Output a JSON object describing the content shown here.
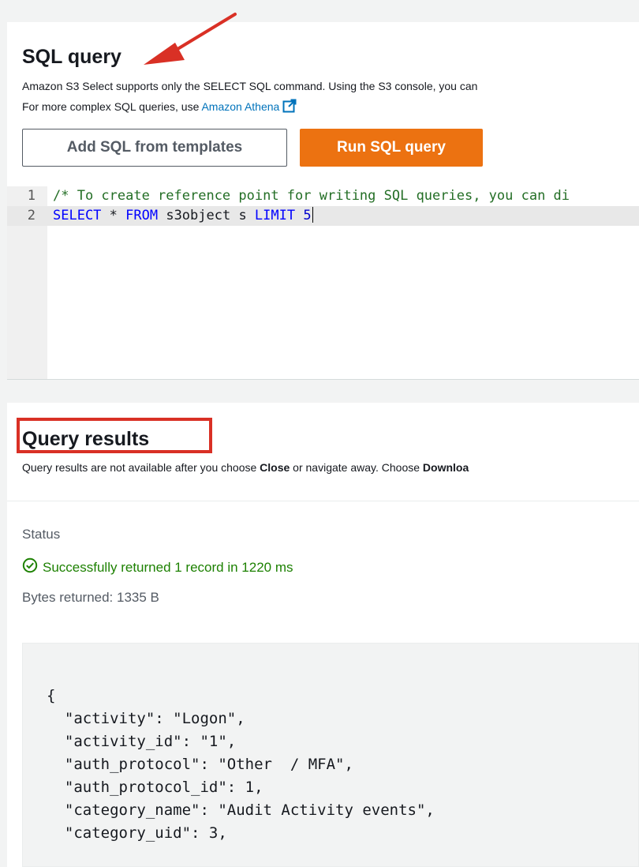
{
  "sql_query": {
    "title": "SQL query",
    "description_line1": "Amazon S3 Select supports only the SELECT SQL command. Using the S3 console, you can",
    "description_line2_prefix": "For more complex SQL queries, use ",
    "athena_link": "Amazon Athena",
    "add_templates_label": "Add SQL from templates",
    "run_query_label": "Run SQL query",
    "editor": {
      "line_numbers": [
        "1",
        "2"
      ],
      "line1_comment": "/* To create reference point for writing SQL queries, you can di",
      "line2": {
        "kw_select": "SELECT",
        "star": " * ",
        "kw_from": "FROM",
        "table": " s3object s ",
        "kw_limit": "LIMIT",
        "space": " ",
        "limit_value": "5"
      }
    }
  },
  "query_results": {
    "title": "Query results",
    "description_prefix": "Query results are not available after you choose ",
    "close_word": "Close",
    "description_middle": " or navigate away. Choose ",
    "download_word": "Downloa",
    "status_label": "Status",
    "status_message": "Successfully returned 1 record in 1220 ms",
    "bytes_returned": "Bytes returned: 1335 B",
    "json_lines": [
      "{",
      "  \"activity\": \"Logon\",",
      "  \"activity_id\": \"1\",",
      "  \"auth_protocol\": \"Other  / MFA\",",
      "  \"auth_protocol_id\": 1,",
      "  \"category_name\": \"Audit Activity events\",",
      "  \"category_uid\": 3,"
    ]
  },
  "colors": {
    "accent_orange": "#ec7211",
    "link_blue": "#0073bb",
    "success_green": "#1d8102",
    "annotation_red": "#d93025"
  }
}
